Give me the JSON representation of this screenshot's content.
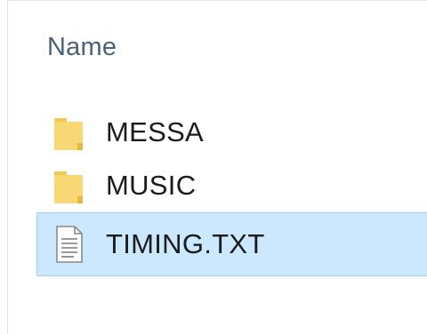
{
  "header": {
    "name_column": "Name"
  },
  "files": [
    {
      "name": "MESSA",
      "icon": "folder-icon",
      "selected": false
    },
    {
      "name": "MUSIC",
      "icon": "folder-icon",
      "selected": false
    },
    {
      "name": "TIMING.TXT",
      "icon": "text-file-icon",
      "selected": true
    }
  ],
  "colors": {
    "selection_background": "#cce8ff",
    "selection_border": "#99d1ff",
    "folder": "#f8d775",
    "header_text": "#4c607a"
  }
}
